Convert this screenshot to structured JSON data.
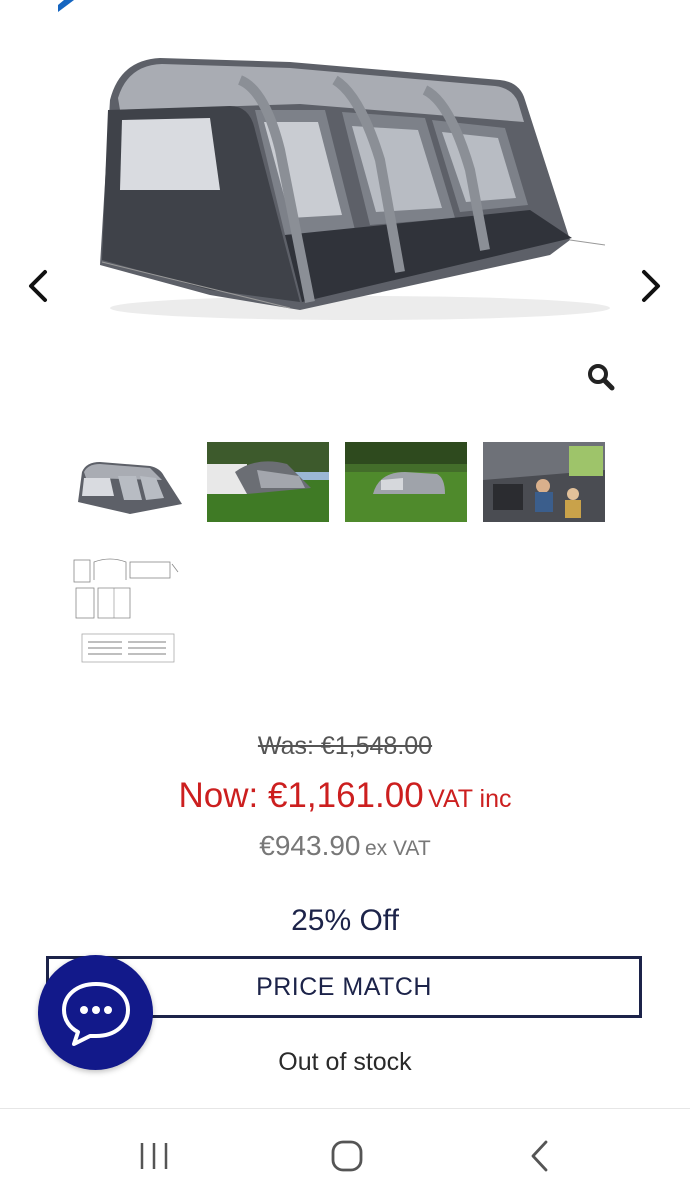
{
  "colors": {
    "accent_blue": "#1565c0",
    "navy": "#1c2349",
    "chat_blue": "#12198a",
    "sale_red": "#cc1f1f",
    "muted_gray": "#777777"
  },
  "gallery": {
    "prev_icon": "chevron-left-icon",
    "next_icon": "chevron-right-icon",
    "zoom_icon": "magnifier-icon"
  },
  "pricing": {
    "was": "Was: €1,548.00",
    "now": "Now: €1,161.00",
    "vat_inc": "VAT inc",
    "ex_vat_price": "€943.90",
    "ex_vat_label": "ex VAT",
    "discount": "25% Off",
    "price_match": "PRICE MATCH",
    "stock_status": "Out of stock"
  },
  "chat": {
    "icon": "chat-bubble-icon"
  },
  "system_nav": {
    "recent_icon": "recent-apps-icon",
    "home_icon": "home-icon",
    "back_icon": "back-icon"
  }
}
